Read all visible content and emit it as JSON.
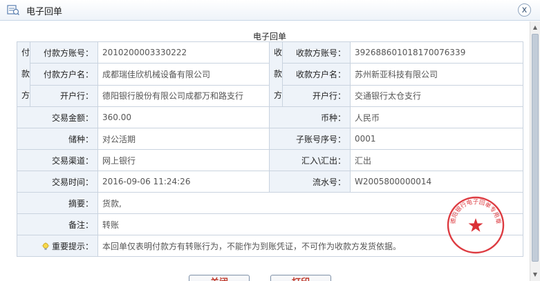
{
  "window": {
    "title": "电子回单",
    "close_glyph": "x"
  },
  "receipt": {
    "title": "电子回单",
    "payer_side_chars": [
      "付",
      "款",
      "方"
    ],
    "payee_side_chars": [
      "收",
      "款",
      "方"
    ],
    "payer": {
      "account_label": "付款方账号：",
      "account": "2010200003330222",
      "name_label": "付款方户名：",
      "name": "成都瑞佳欣机械设备有限公司",
      "bank_label": "开户行：",
      "bank": "德阳银行股份有限公司成都万和路支行"
    },
    "payee": {
      "account_label": "收款方账号：",
      "account": "392688601018170076339",
      "name_label": "收款方户名：",
      "name": "苏州新亚科技有限公司",
      "bank_label": "开户行：",
      "bank": "交通银行太仓支行"
    },
    "amount_label": "交易金额：",
    "amount": "360.00",
    "currency_label": "币种：",
    "currency": "人民币",
    "deposit_type_label": "储种：",
    "deposit_type": "对公活期",
    "sub_account_label": "子账号序号：",
    "sub_account": "0001",
    "channel_label": "交易渠道：",
    "channel": "网上银行",
    "direction_label": "汇入\\汇出：",
    "direction": "汇出",
    "time_label": "交易时间：",
    "time": "2016-09-06 11:24:26",
    "serial_label": "流水号：",
    "serial": "W2005800000014",
    "summary_label": "摘要：",
    "summary": "货款,",
    "remark_label": "备注：",
    "remark": "转账",
    "notice_label": "重要提示：",
    "notice": "本回单仅表明付款方有转账行为，不能作为到账凭证，不可作为收款方发货依据。"
  },
  "seal": {
    "text": "德阳银行电子回单专用章",
    "color": "#d9262c",
    "icon": "star-icon"
  },
  "buttons": {
    "close_label": "关闭",
    "print_label": "打印"
  },
  "colors": {
    "label_bg": "#eef3f9",
    "border": "#c9d3df",
    "button_text": "#c0392b"
  }
}
